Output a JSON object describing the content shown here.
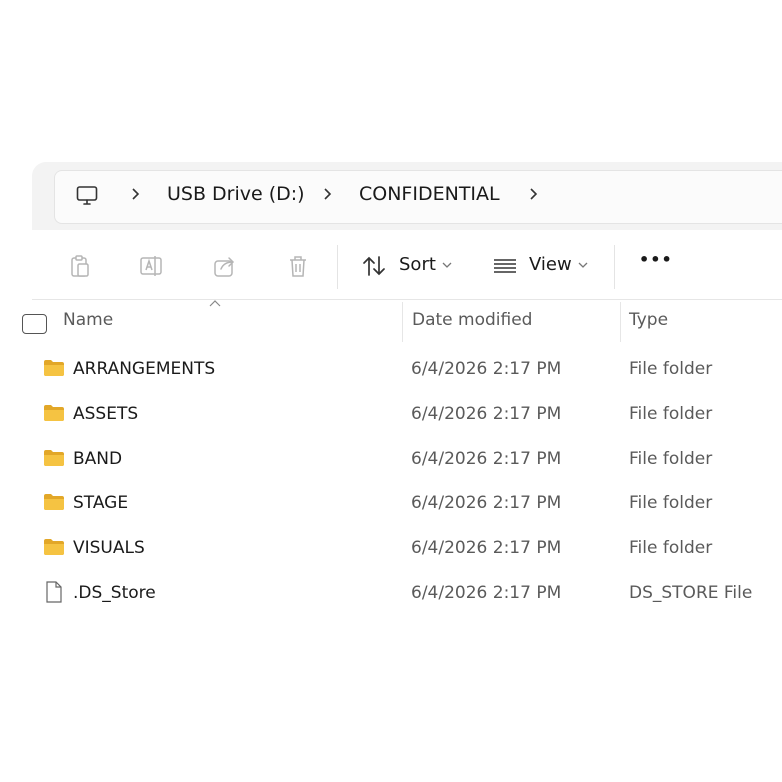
{
  "breadcrumb": {
    "items": [
      "USB Drive (D:)",
      "CONFIDENTIAL"
    ]
  },
  "toolbar": {
    "sort_label": "Sort",
    "view_label": "View",
    "more_label": "•••"
  },
  "columns": {
    "name": "Name",
    "date": "Date modified",
    "type": "Type"
  },
  "files": [
    {
      "name": "ARRANGEMENTS",
      "date": "6/4/2026 2:17 PM",
      "type": "File folder",
      "icon": "folder-icon"
    },
    {
      "name": "ASSETS",
      "date": "6/4/2026 2:17 PM",
      "type": "File folder",
      "icon": "folder-icon"
    },
    {
      "name": "BAND",
      "date": "6/4/2026 2:17 PM",
      "type": "File folder",
      "icon": "folder-icon"
    },
    {
      "name": "STAGE",
      "date": "6/4/2026 2:17 PM",
      "type": "File folder",
      "icon": "folder-icon"
    },
    {
      "name": "VISUALS",
      "date": "6/4/2026 2:17 PM",
      "type": "File folder",
      "icon": "folder-icon"
    },
    {
      "name": ".DS_Store",
      "date": "6/4/2026 2:17 PM",
      "type": "DS_STORE File",
      "icon": "file-icon"
    }
  ],
  "colors": {
    "folder": "#f5c342",
    "folder_dark": "#e2a728",
    "muted_text": "#5a5a5a",
    "disabled_icon": "#b5b5b5"
  }
}
